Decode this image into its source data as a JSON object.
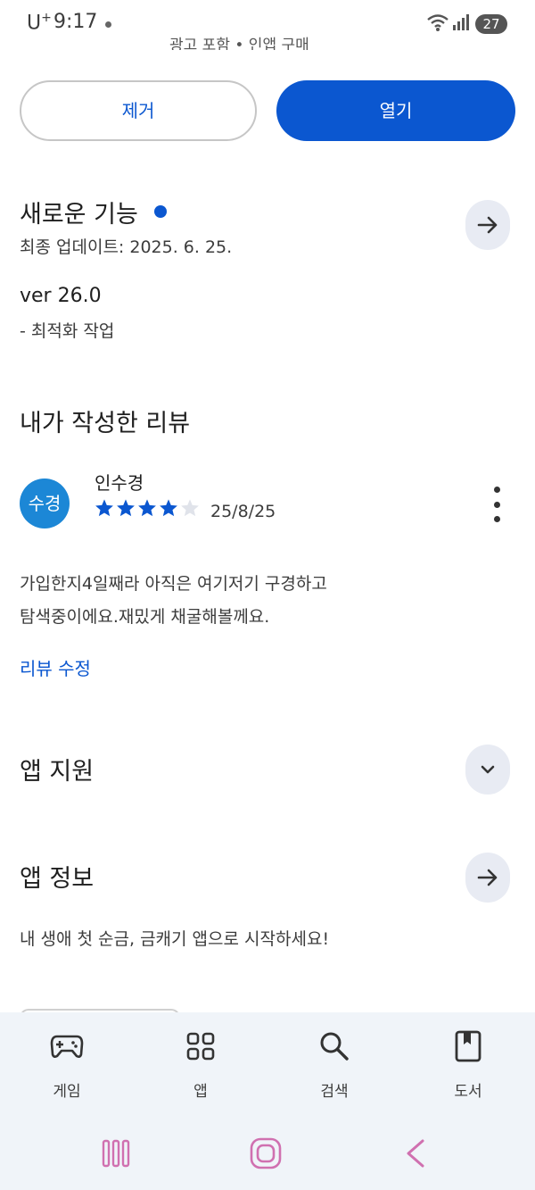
{
  "status_bar": {
    "carrier": "U",
    "carrier_sup": "+",
    "time": "9:17",
    "battery": "27"
  },
  "top_partial": "광고 포함 • 인앱 구매",
  "actions": {
    "remove_label": "제거",
    "open_label": "열기"
  },
  "whats_new": {
    "title": "새로운 기능",
    "updated": "최종 업데이트: 2025. 6. 25.",
    "version": "ver 26.0",
    "notes": "- 최적화 작업"
  },
  "my_review": {
    "title": "내가 작성한 리뷰",
    "avatar_text": "수경",
    "avatar_color": "#1c87d6",
    "reviewer": "인수경",
    "rating": 4,
    "rating_max": 5,
    "date": "25/8/25",
    "text_line1": "가입한지4일째라 아직은 여기저기 구경하고",
    "text_line2": "탐색중이에요.재밌게 채굴해볼께요.",
    "edit_label": "리뷰 수정"
  },
  "app_support": {
    "title": "앱 지원"
  },
  "app_info": {
    "title": "앱 정보",
    "description": "내 생애 첫 순금, 금캐기 앱으로 시작하세요!"
  },
  "bottom_nav": {
    "items": [
      {
        "label": "게임",
        "icon": "gamepad-icon"
      },
      {
        "label": "앱",
        "icon": "apps-grid-icon"
      },
      {
        "label": "검색",
        "icon": "search-icon"
      },
      {
        "label": "도서",
        "icon": "book-icon"
      }
    ]
  },
  "colors": {
    "accent": "#0b57d0",
    "nav_bg": "#f0f4f9",
    "round_btn_bg": "#e8ebf3",
    "system_nav": "#d070b0"
  }
}
